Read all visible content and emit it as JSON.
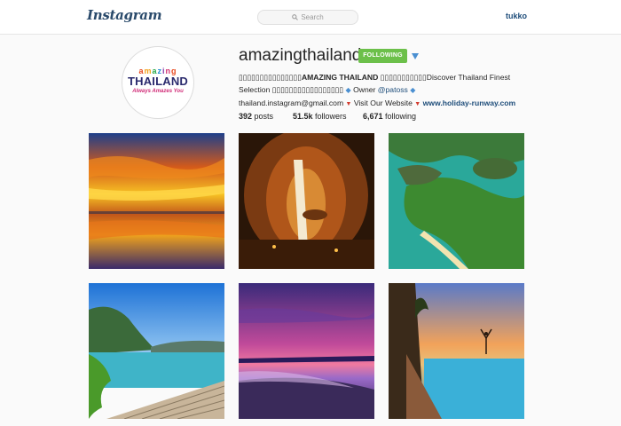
{
  "header": {
    "logo": "Instagram",
    "search_placeholder": "Search",
    "current_user": "tukko"
  },
  "profile": {
    "avatar": {
      "brand_top": [
        "a",
        "m",
        "a",
        "z",
        "i",
        "n",
        "g"
      ],
      "brand_main": "THAILAND",
      "tagline": "Always Amazes You"
    },
    "username": "amazingthailand",
    "follow_label": "FOLLOWING",
    "bio": {
      "line1_prefix": "▯▯▯▯▯▯▯▯▯▯▯▯▯▯▯",
      "line1_bold": "AMAZING THAILAND",
      "line1_mid": " ▯▯▯▯▯▯▯▯▯▯▯",
      "line1_suffix": "Discover Thailand Finest",
      "line2_prefix": "Selection ▯▯▯▯▯▯▯▯▯▯▯▯▯▯▯▯▯ ",
      "line2_owner": " Owner ",
      "line2_mention": "@patoss",
      "line3_email": "thailand.instagram@gmail.com ",
      "line3_visit": " Visit Our Website ",
      "line3_link": "www.holiday-runway.com"
    },
    "stats": [
      {
        "value": "392",
        "label": "posts"
      },
      {
        "value": "51.5k",
        "label": "followers"
      },
      {
        "value": "6,671",
        "label": "following"
      }
    ]
  },
  "photos": [
    {
      "alt": "sunset-reflection-photo"
    },
    {
      "alt": "cave-waterfall-photo"
    },
    {
      "alt": "aerial-island-photo"
    },
    {
      "alt": "boardwalk-bay-photo"
    },
    {
      "alt": "purple-beach-sunset-photo"
    },
    {
      "alt": "infinity-pool-sunset-photo"
    }
  ],
  "colors": {
    "accent_link": "#1e4d7a",
    "follow_green": "#6cc04a",
    "dropdown_blue": "#4a8fd1"
  }
}
